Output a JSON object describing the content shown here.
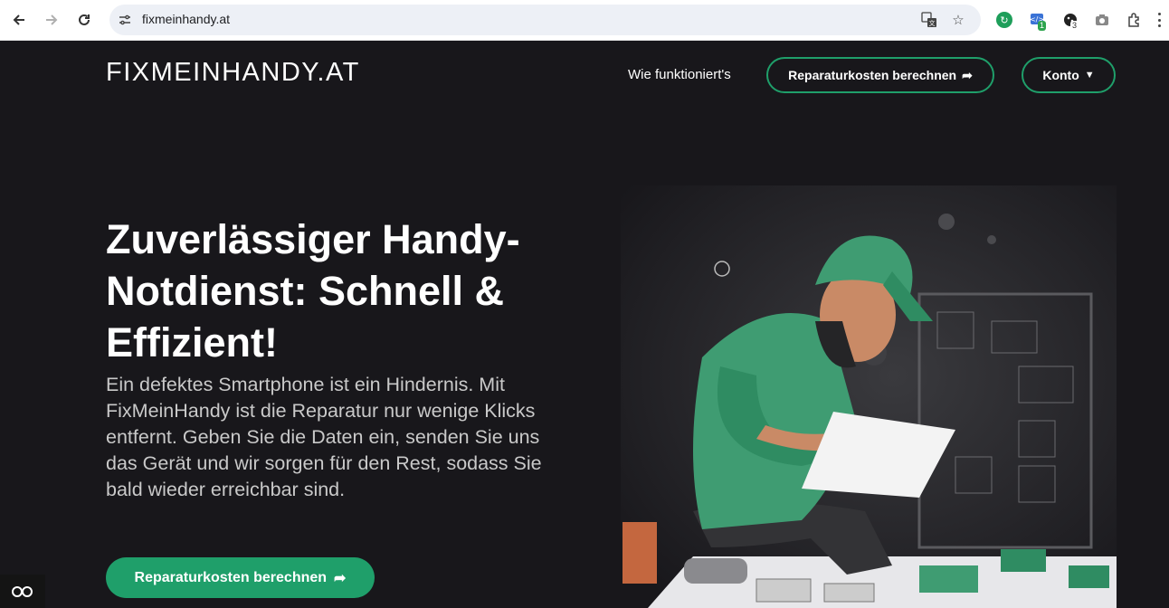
{
  "browser": {
    "url": "fixmeinhandy.at",
    "extension_badges": [
      "1",
      "3"
    ]
  },
  "header": {
    "logo": "FIXMEINHANDY.AT",
    "nav_link": "Wie funktioniert's",
    "calc_button": "Reparaturkosten berechnen",
    "account_button": "Konto",
    "accent_color": "#1f9f6a"
  },
  "hero": {
    "title_lines": [
      "Zuverlässiger Handy-",
      "Notdienst: Schnell &",
      "Effizient!"
    ],
    "text_lines": [
      "Ein defektes Smartphone ist ein Hindernis. Mit",
      "FixMeinHandy ist die Reparatur nur wenige Klicks",
      "entfernt. Geben Sie die Daten ein, senden Sie uns",
      "das Gerät und wir sorgen für den Rest, sodass Sie",
      "bald wieder erreichbar sind."
    ],
    "cta_label": "Reparaturkosten berechnen",
    "cta_icon": "share-arrow-icon"
  }
}
